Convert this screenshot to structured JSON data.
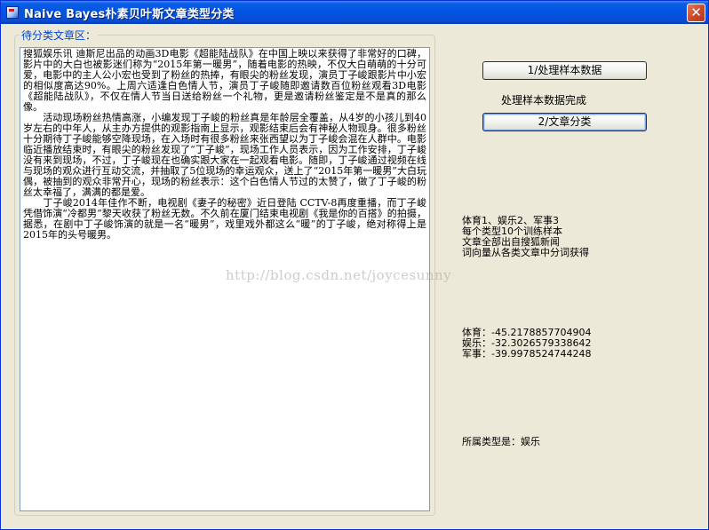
{
  "window": {
    "title": "Naive Bayes朴素贝叶斯文章类型分类",
    "close_glyph": "✕"
  },
  "group": {
    "label": "待分类文章区："
  },
  "article": {
    "paragraphs": [
      "搜狐娱乐讯 迪斯尼出品的动画3D电影《超能陆战队》在中国上映以来获得了非常好的口碑，影片中的大白也被影迷们称为“2015年第一暖男”，随着电影的热映，不仅大白萌萌的十分可爱，电影中的主人公小宏也受到了粉丝的热捧，有眼尖的粉丝发现，演员丁子峻跟影片中小宏的相似度高达90%。上周六适逢白色情人节，演员丁子峻随即邀请数百位粉丝观看3D电影《超能陆战队》，不仅在情人节当日送给粉丝一个礼物，更是邀请粉丝鉴定是不是真的那么像。",
      "　　活动现场粉丝热情高涨，小编发现丁子峻的粉丝真是年龄层全覆盖，从4岁的小孩儿到40岁左右的中年人，从主办方提供的观影指南上显示，观影结束后会有神秘人物现身。很多粉丝十分期待丁子峻能够空降现场，在入场时有很多粉丝来张西望以为丁子峻会混在人群中。电影临近播放结束时，有眼尖的粉丝发现了“丁子峻”，现场工作人员表示，因为工作安排，丁子峻没有来到现场，不过，丁子峻现在也确实跟大家在一起观看电影。随即，丁子峻通过视频在线与现场的观众进行互动交流，并抽取了5位现场的幸运观众，送上了“2015年第一暖男”大白玩偶，被抽到的观众非常开心，现场的粉丝表示：这个白色情人节过的太赞了，做了丁子峻的粉丝太幸福了，满满的都是爱。",
      "　　丁子峻2014年佳作不断，电视剧《妻子的秘密》近日登陆 CCTV-8再度重播，而丁子峻凭借饰演“冷都男”黎天收获了粉丝无数。不久前在厦门结束电视剧《我是你的百搭》的拍摄，据悉，在剧中丁子峻饰演的就是一名“暖男”，戏里戏外都这么“暖”的丁子峻，绝对称得上是2015年的头号暖男。"
    ]
  },
  "buttons": {
    "process_label": "1/处理样本数据",
    "classify_label": "2/文章分类"
  },
  "status": {
    "processed_text": "处理样本数据完成"
  },
  "info": {
    "lines": [
      "体育1、娱乐2、军事3",
      "每个类型10个训练样本",
      "文章全部出自搜狐新闻",
      "词向量从各类文章中分词获得"
    ]
  },
  "scores": {
    "lines": [
      "体育：-45.2178857704904",
      "娱乐：-32.3026579338642",
      "军事：-39.9978524744248"
    ]
  },
  "result": {
    "text": "所属类型是：娱乐"
  },
  "watermark": {
    "text": "http://blog.csdn.net/joycesunny"
  }
}
